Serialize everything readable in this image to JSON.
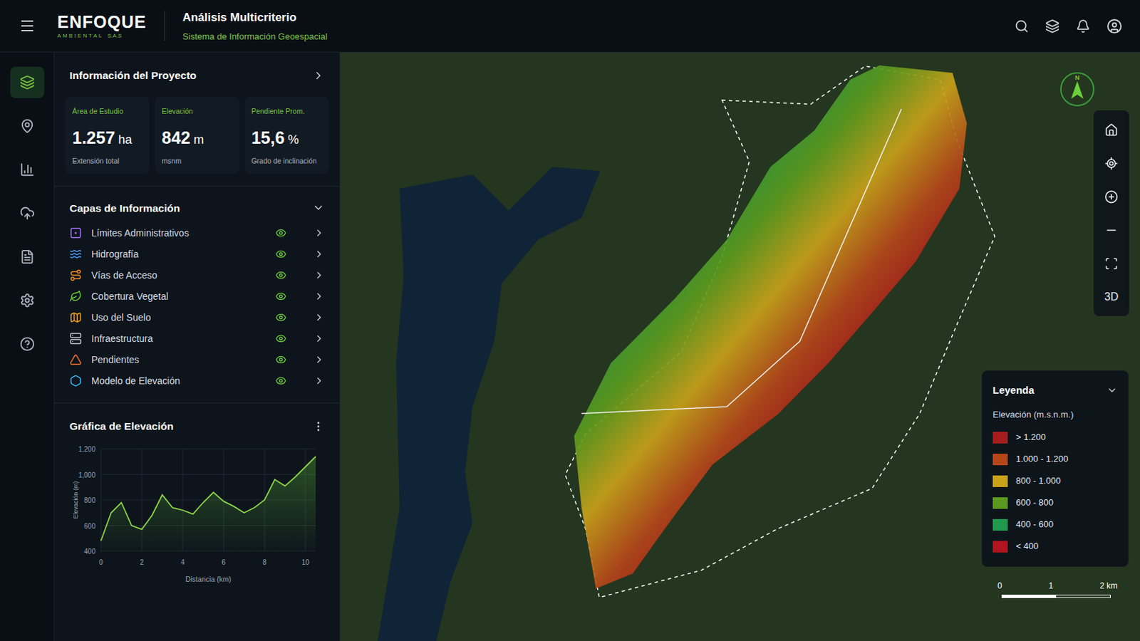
{
  "header": {
    "logo": {
      "name": "ENFOQUE",
      "tagline": "AMBIENTAL",
      "suffix": "S.A.S"
    },
    "title": "Análisis Multicriterio",
    "subtitle": "Sistema de Información Geoespacial"
  },
  "rail": [
    {
      "selected": true
    },
    {
      "selected": false
    },
    {
      "selected": false
    },
    {
      "selected": false
    },
    {
      "selected": false
    },
    {
      "selected": false
    },
    {
      "selected": false
    }
  ],
  "project": {
    "title": "Información del Proyecto",
    "cards": [
      {
        "label": "Área de Estudio",
        "value": "1.257",
        "unit": "ha",
        "note": "Extensión total"
      },
      {
        "label": "Elevación",
        "value": "842",
        "unit": "m",
        "note": "msnm"
      },
      {
        "label": "Pendiente Prom.",
        "value": "15,6",
        "unit": "%",
        "note": "Grado de inclinación"
      }
    ]
  },
  "layers": {
    "title": "Capas de Información",
    "expanded": true,
    "items": [
      {
        "name": "Límites Administrativos",
        "visible": true,
        "color": "#a371f7"
      },
      {
        "name": "Hidrografía",
        "visible": true,
        "color": "#4aa3ff"
      },
      {
        "name": "Vías de Acceso",
        "visible": true,
        "color": "#f08a24"
      },
      {
        "name": "Cobertura Vegetal",
        "visible": true,
        "color": "#6ccf3a"
      },
      {
        "name": "Uso del Suelo",
        "visible": true,
        "color": "#f0a020"
      },
      {
        "name": "Infraestructura",
        "visible": true,
        "color": "#c0c7d0"
      },
      {
        "name": "Pendientes",
        "visible": true,
        "color": "#f0702a"
      },
      {
        "name": "Modelo de Elevación",
        "visible": true,
        "color": "#38bdf8"
      }
    ]
  },
  "chart": {
    "title": "Gráfica de Elevación",
    "y_label": "Elevación (m)",
    "x_label": "Distancia (km)",
    "y_ticks": [
      {
        "label": "1.200",
        "value": 1200
      },
      {
        "label": "1,000",
        "value": 1000
      },
      {
        "label": "800",
        "value": 800
      },
      {
        "label": "600",
        "value": 600
      },
      {
        "label": "400",
        "value": 400
      }
    ],
    "x_ticks": [
      {
        "label": "0",
        "value": 0
      },
      {
        "label": "2",
        "value": 2
      },
      {
        "label": "4",
        "value": 4
      },
      {
        "label": "6",
        "value": 6
      },
      {
        "label": "8",
        "value": 8
      },
      {
        "label": "10",
        "value": 10
      }
    ],
    "step_km": 0.5,
    "elevation_m": [
      480,
      700,
      780,
      600,
      570,
      680,
      840,
      740,
      720,
      690,
      780,
      860,
      790,
      750,
      700,
      740,
      800,
      960,
      910,
      980,
      1060,
      1140
    ]
  },
  "map": {
    "compass": "N",
    "tool_3d": "3D",
    "legend": {
      "title": "Leyenda",
      "subtitle": "Elevación (m.s.n.m.)",
      "expanded": true,
      "items": [
        {
          "label": "> 1.200",
          "color": "#a61c1c"
        },
        {
          "label": "1.000 - 1.200",
          "color": "#b5461a"
        },
        {
          "label": "800 - 1.000",
          "color": "#c9a21a"
        },
        {
          "label": "600 - 800",
          "color": "#5a9a1e"
        },
        {
          "label": "400 - 600",
          "color": "#1f9a4d"
        },
        {
          "label": "< 400",
          "color": "#b0141e"
        }
      ]
    },
    "scale": [
      "0",
      "1",
      "2 km"
    ]
  }
}
